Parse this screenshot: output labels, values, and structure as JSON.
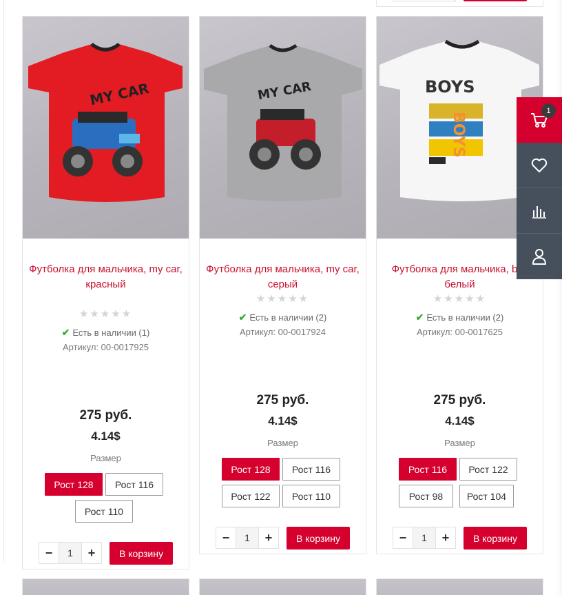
{
  "products": [
    {
      "title": "Футболка для мальчика, my car, красный",
      "rating": 0,
      "stars": "★★★★★",
      "stock": "Есть в наличии (1)",
      "sku": "Артикул: 00-0017925",
      "price": "275 руб.",
      "price_usd": "4.14$",
      "size_label": "Размер",
      "sizes": [
        "Рост 128",
        "Рост 116",
        "Рост 110"
      ],
      "selected_size": "Рост 128",
      "quantity": "1",
      "cart_label": "В корзину",
      "shirt_color": "#e31b23",
      "image_text": "MY CAR"
    },
    {
      "title": "Футболка для мальчика, my car, серый",
      "rating": 0,
      "stars": "★★★★★",
      "stock": "Есть в наличии (2)",
      "sku": "Артикул: 00-0017924",
      "price": "275 руб.",
      "price_usd": "4.14$",
      "size_label": "Размер",
      "sizes": [
        "Рост 128",
        "Рост 116",
        "Рост 122",
        "Рост 110"
      ],
      "selected_size": "Рост 128",
      "quantity": "1",
      "cart_label": "В корзину",
      "shirt_color": "#a9a9ab",
      "image_text": "MY CAR"
    },
    {
      "title": "Футболка для мальчика, b… белый",
      "rating": 0,
      "stars": "★★★★★",
      "stock": "Есть в наличии (2)",
      "sku": "Артикул: 00-0017625",
      "price": "275 руб.",
      "price_usd": "4.14$",
      "size_label": "Размер",
      "sizes": [
        "Рост 116",
        "Рост 122",
        "Рост 98",
        "Рост 104"
      ],
      "selected_size": "Рост 116",
      "quantity": "1",
      "cart_label": "В корзину",
      "shirt_color": "#f6f6f6",
      "image_text": "BOYS"
    }
  ],
  "side_panel": {
    "cart_count": "1",
    "items": [
      "cart-icon",
      "heart-icon",
      "chart-icon",
      "user-icon"
    ]
  },
  "colors": {
    "accent": "#d6002f",
    "title": "#c8102e",
    "in_stock": "#3aaa35",
    "panel": "#46505c"
  }
}
